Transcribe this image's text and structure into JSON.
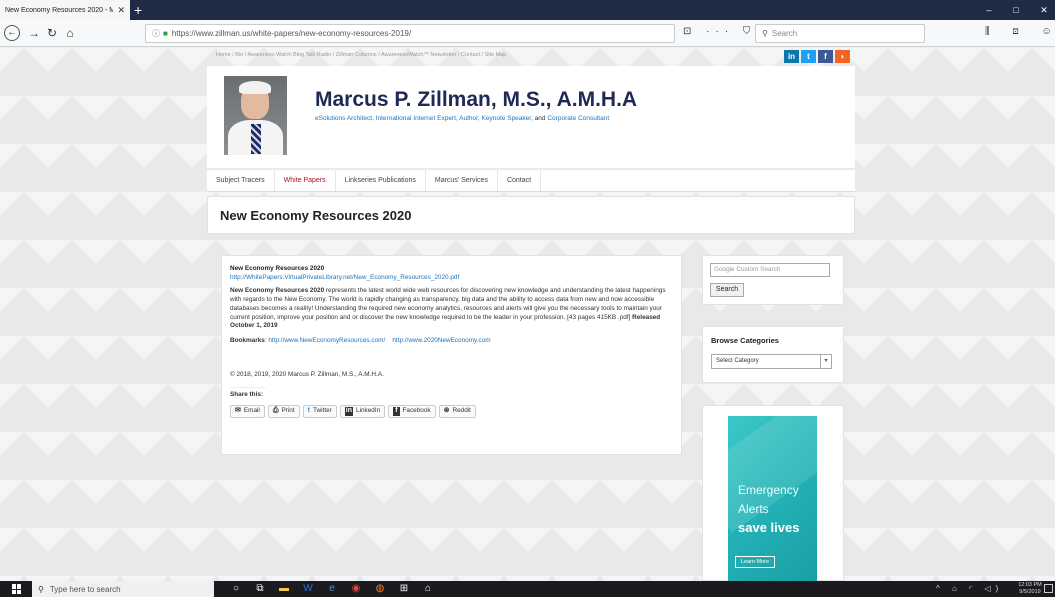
{
  "browser": {
    "tab_title": "New Economy Resources 2020 - M...",
    "tab_close": "✕",
    "new_tab": "+",
    "url_host": "https://www.zillman.us",
    "url_path": "/white-papers/new-economy-resources-2019/",
    "search_placeholder": "Search",
    "window_controls": [
      "–",
      "□",
      "✕"
    ],
    "url_icons": "⊡ ··· ⛉ ☆",
    "right_icons": "⫼ ⊡ ☺ ≡"
  },
  "site": {
    "top_links": "Home / Bio / Awareness Watch Blog Talk Radio / Zillman Columns / AwarenessWatch™ Newsletter / Contact / Site Map",
    "social": {
      "linkedin": "in",
      "twitter": "t",
      "facebook": "f",
      "rss": "◗"
    },
    "title": "Marcus P. Zillman, M.S., A.M.H.A",
    "tagline": {
      "part1": "eSolutions Architect, International Internet Expert, Author, Keynote Speaker,",
      "and": " and ",
      "part2": "Corporate Consultant"
    },
    "nav": [
      "Subject Tracers",
      "White Papers",
      "Linkseries Publications",
      "Marcus' Services",
      "Contact"
    ],
    "nav_active_index": 1
  },
  "page": {
    "title": "New Economy Resources 2020",
    "content": {
      "heading": "New Economy Resources 2020",
      "link": "http://WhitePapers.VirtualPrivateLibrary.net/New_Economy_Resources_2020.pdf",
      "body_bold": "New Economy Resources 2020",
      "body": " represents the latest world wide web resources for discovering new knowledge and understanding the latest happenings with regards to the New Economy. The world is rapidly changing as transparency, big data and the ability to access data from new and now accessible databases becomes a reality! Understanding the required new economy analytics, resources and alerts will give you the necessary tools to maintain your current position, improve your position and or discover the new knowledge required to be the leader in your profession. [43 pages  415KB .pdf] ",
      "released": "Released October 1, 2019",
      "bookmarks_label": "Bookmarks",
      "bookmarks_colon": ": ",
      "bookmark1": "http://www.NewEconomyResources.com/",
      "bookmark2": "http://www.2020NewEconomy.com",
      "copyright": "© 2018, 2019, 2020 Marcus P. Zillman, M.S., A.M.H.A.",
      "share_title": "Share this:",
      "share": [
        {
          "icon": "✉",
          "label": "Email"
        },
        {
          "icon": "⎙",
          "label": "Print"
        },
        {
          "icon": "t",
          "label": "Twitter"
        },
        {
          "icon": "in",
          "label": "LinkedIn"
        },
        {
          "icon": "f",
          "label": "Facebook"
        },
        {
          "icon": "⊛",
          "label": "Reddit"
        }
      ]
    }
  },
  "sidebar": {
    "search_placeholder": "Google Custom Search",
    "search_button": "Search",
    "browse_title": "Browse Categories",
    "browse_select": "Select Category",
    "ad": {
      "line1": "Emergency",
      "line2": "Alerts",
      "line3": "save lives",
      "button": "Learn More"
    }
  },
  "taskbar": {
    "search_placeholder": "Type here to search",
    "tray": "^ ⌂ ◜ ◁)",
    "time": "12:03 PM",
    "date": "9/5/2019"
  }
}
